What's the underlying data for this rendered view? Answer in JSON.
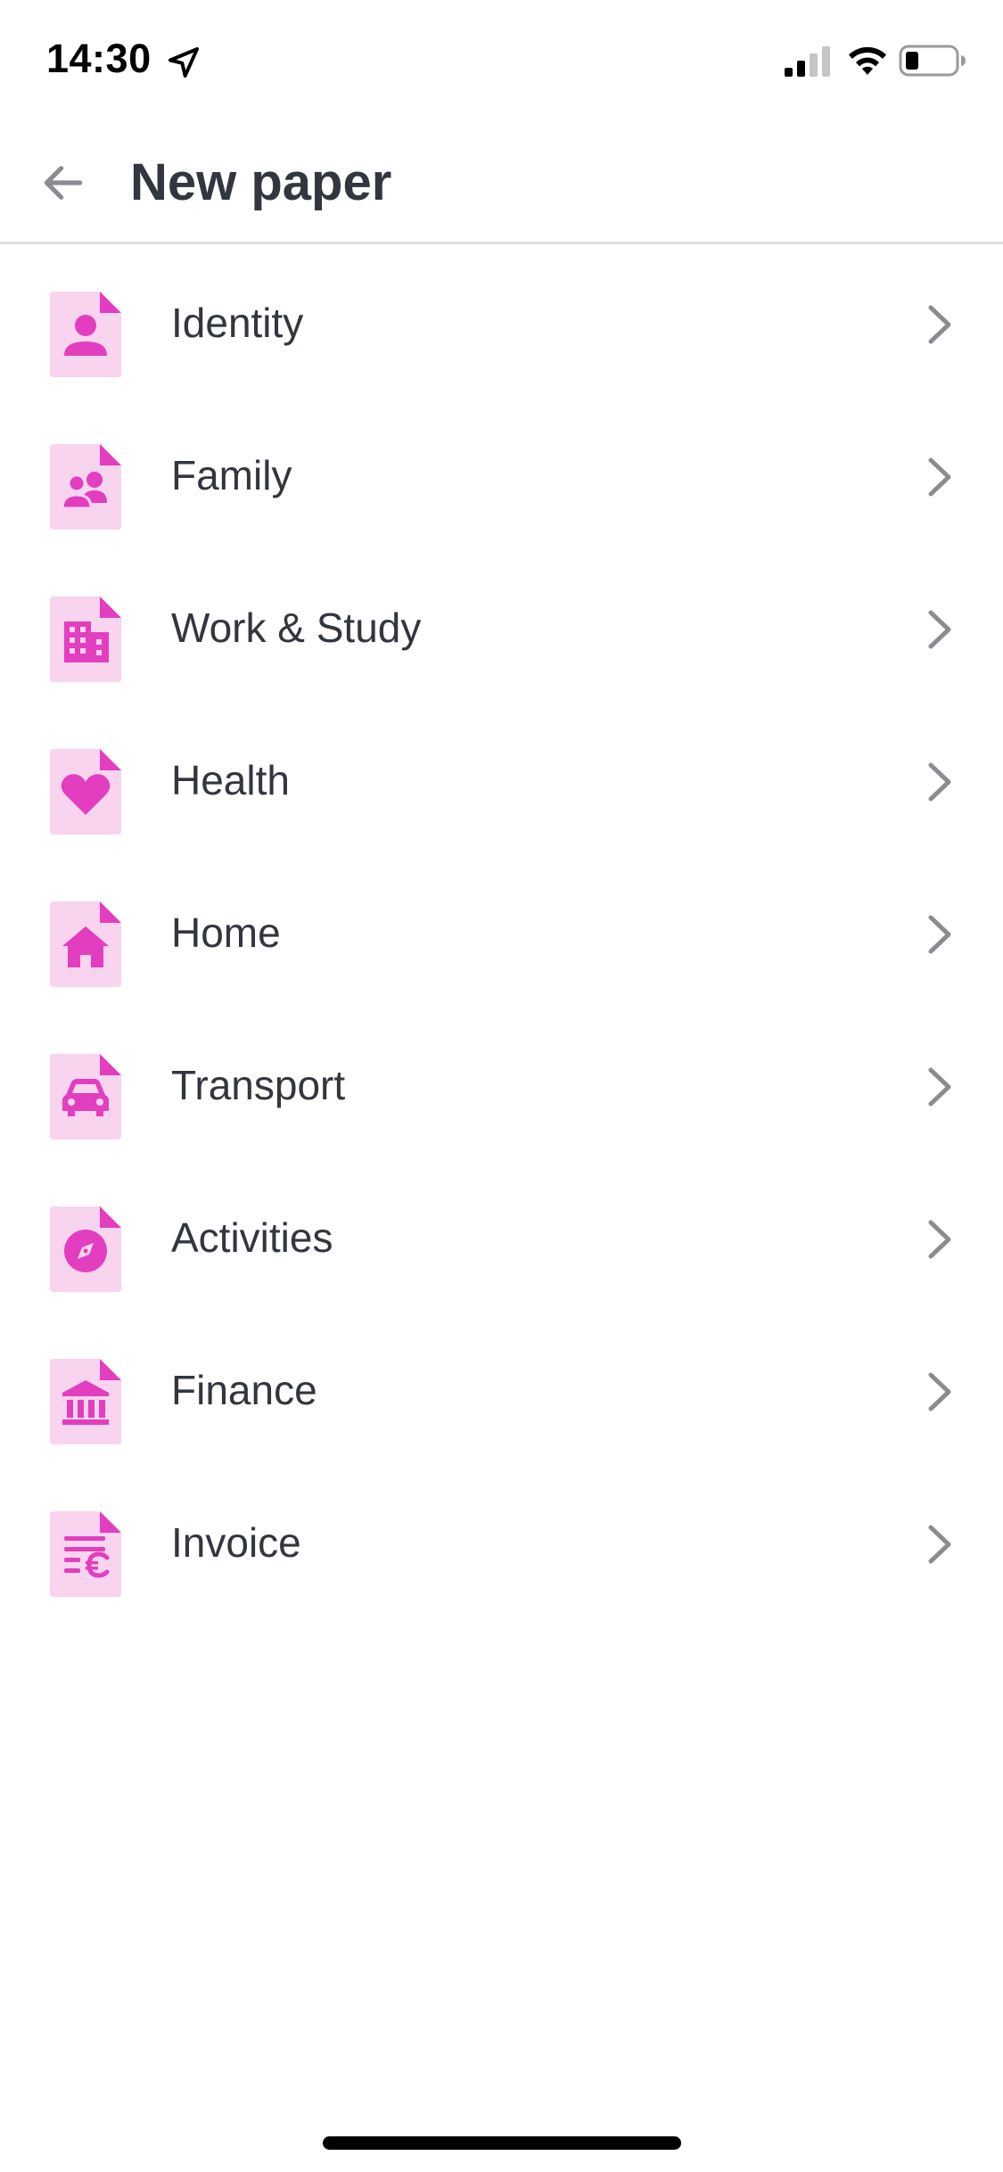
{
  "status_bar": {
    "time": "14:30",
    "icons": [
      "location-arrow-icon",
      "cellular-signal-icon",
      "wifi-icon",
      "battery-icon"
    ]
  },
  "header": {
    "title": "New paper",
    "back_icon": "arrow-left-icon"
  },
  "colors": {
    "accent": "#e23ebf",
    "icon_bg": "#f8d4ee",
    "text": "#32363f",
    "chevron": "#8a8c91",
    "divider": "#e0e1e4"
  },
  "categories": [
    {
      "label": "Identity",
      "icon": "person-icon"
    },
    {
      "label": "Family",
      "icon": "people-icon"
    },
    {
      "label": "Work & Study",
      "icon": "building-icon"
    },
    {
      "label": "Health",
      "icon": "heart-icon"
    },
    {
      "label": "Home",
      "icon": "house-icon"
    },
    {
      "label": "Transport",
      "icon": "car-icon"
    },
    {
      "label": "Activities",
      "icon": "compass-icon"
    },
    {
      "label": "Finance",
      "icon": "bank-icon"
    },
    {
      "label": "Invoice",
      "icon": "invoice-euro-icon"
    }
  ]
}
